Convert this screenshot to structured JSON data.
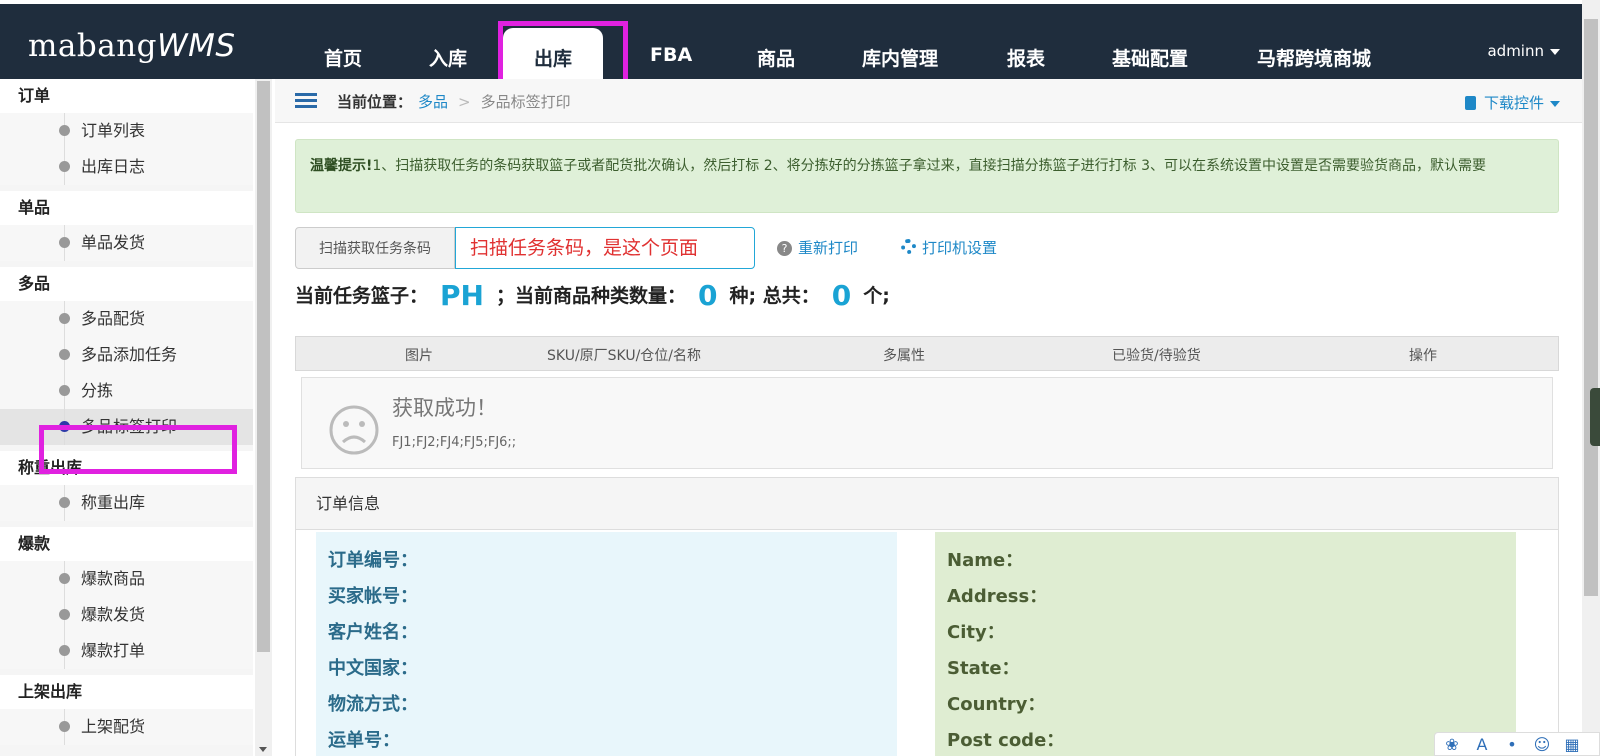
{
  "logo": {
    "main": "mabang",
    "suffix": "WMS"
  },
  "nav": {
    "items": [
      "首页",
      "入库",
      "出库",
      "FBA",
      "商品",
      "库内管理",
      "报表",
      "基础配置",
      "马帮跨境商城"
    ],
    "active_index": 2,
    "user": "adminn"
  },
  "sidebar": {
    "groups": [
      {
        "title": "订单",
        "items": [
          "订单列表",
          "出库日志"
        ]
      },
      {
        "title": "单品",
        "items": [
          "单品发货"
        ]
      },
      {
        "title": "多品",
        "items": [
          "多品配货",
          "多品添加任务",
          "分拣",
          "多品标签打印"
        ]
      },
      {
        "title": "称重出库",
        "items": [
          "称重出库"
        ]
      },
      {
        "title": "爆款",
        "items": [
          "爆款商品",
          "爆款发货",
          "爆款打单"
        ]
      },
      {
        "title": "上架出库",
        "items": [
          "上架配货"
        ]
      }
    ],
    "active_item": "多品标签打印"
  },
  "breadcrumb": {
    "label": "当前位置：",
    "parent": "多品",
    "separator": ">",
    "current": "多品标签打印"
  },
  "download_label": "下载控件",
  "tip": {
    "title": "温馨提示!",
    "text": "1、扫描获取任务的条码获取篮子或者配货批次确认，然后打标     2、将分拣好的分拣篮子拿过来，直接扫描分拣篮子进行打标     3、可以在系统设置中设置是否需要验货商品，默认需要"
  },
  "scan": {
    "label": "扫描获取任务条码",
    "annotation": "扫描任务条码，是这个页面"
  },
  "actions": {
    "reprint": "重新打印",
    "printer_settings": "打印机设置"
  },
  "status": {
    "basket_label": "当前任务篮子：",
    "basket_value": "PH",
    "types_label": "；当前商品种类数量：",
    "types_value": "0",
    "types_unit": "种; 总共：",
    "total_value": "0",
    "total_unit": "个;"
  },
  "table": {
    "headers": [
      "图片",
      "SKU/原厂SKU/仓位/名称",
      "多属性",
      "已验货/待验货",
      "操作"
    ]
  },
  "result": {
    "title": "获取成功！",
    "detail": "FJ1;FJ2;FJ4;FJ5;FJ6;;"
  },
  "order": {
    "title": "订单信息",
    "left_fields": [
      "订单编号：",
      "买家帐号：",
      "客户姓名：",
      "中文国家：",
      "物流方式：",
      "运单号："
    ],
    "right_fields": [
      "Name：",
      "Address：",
      "City：",
      "State：",
      "Country：",
      "Post code："
    ]
  },
  "colors": {
    "nav_bg": "#1f2d3d",
    "accent": "#1e88c7",
    "highlight": "#e021e0",
    "tip_bg": "#dff0d8"
  }
}
